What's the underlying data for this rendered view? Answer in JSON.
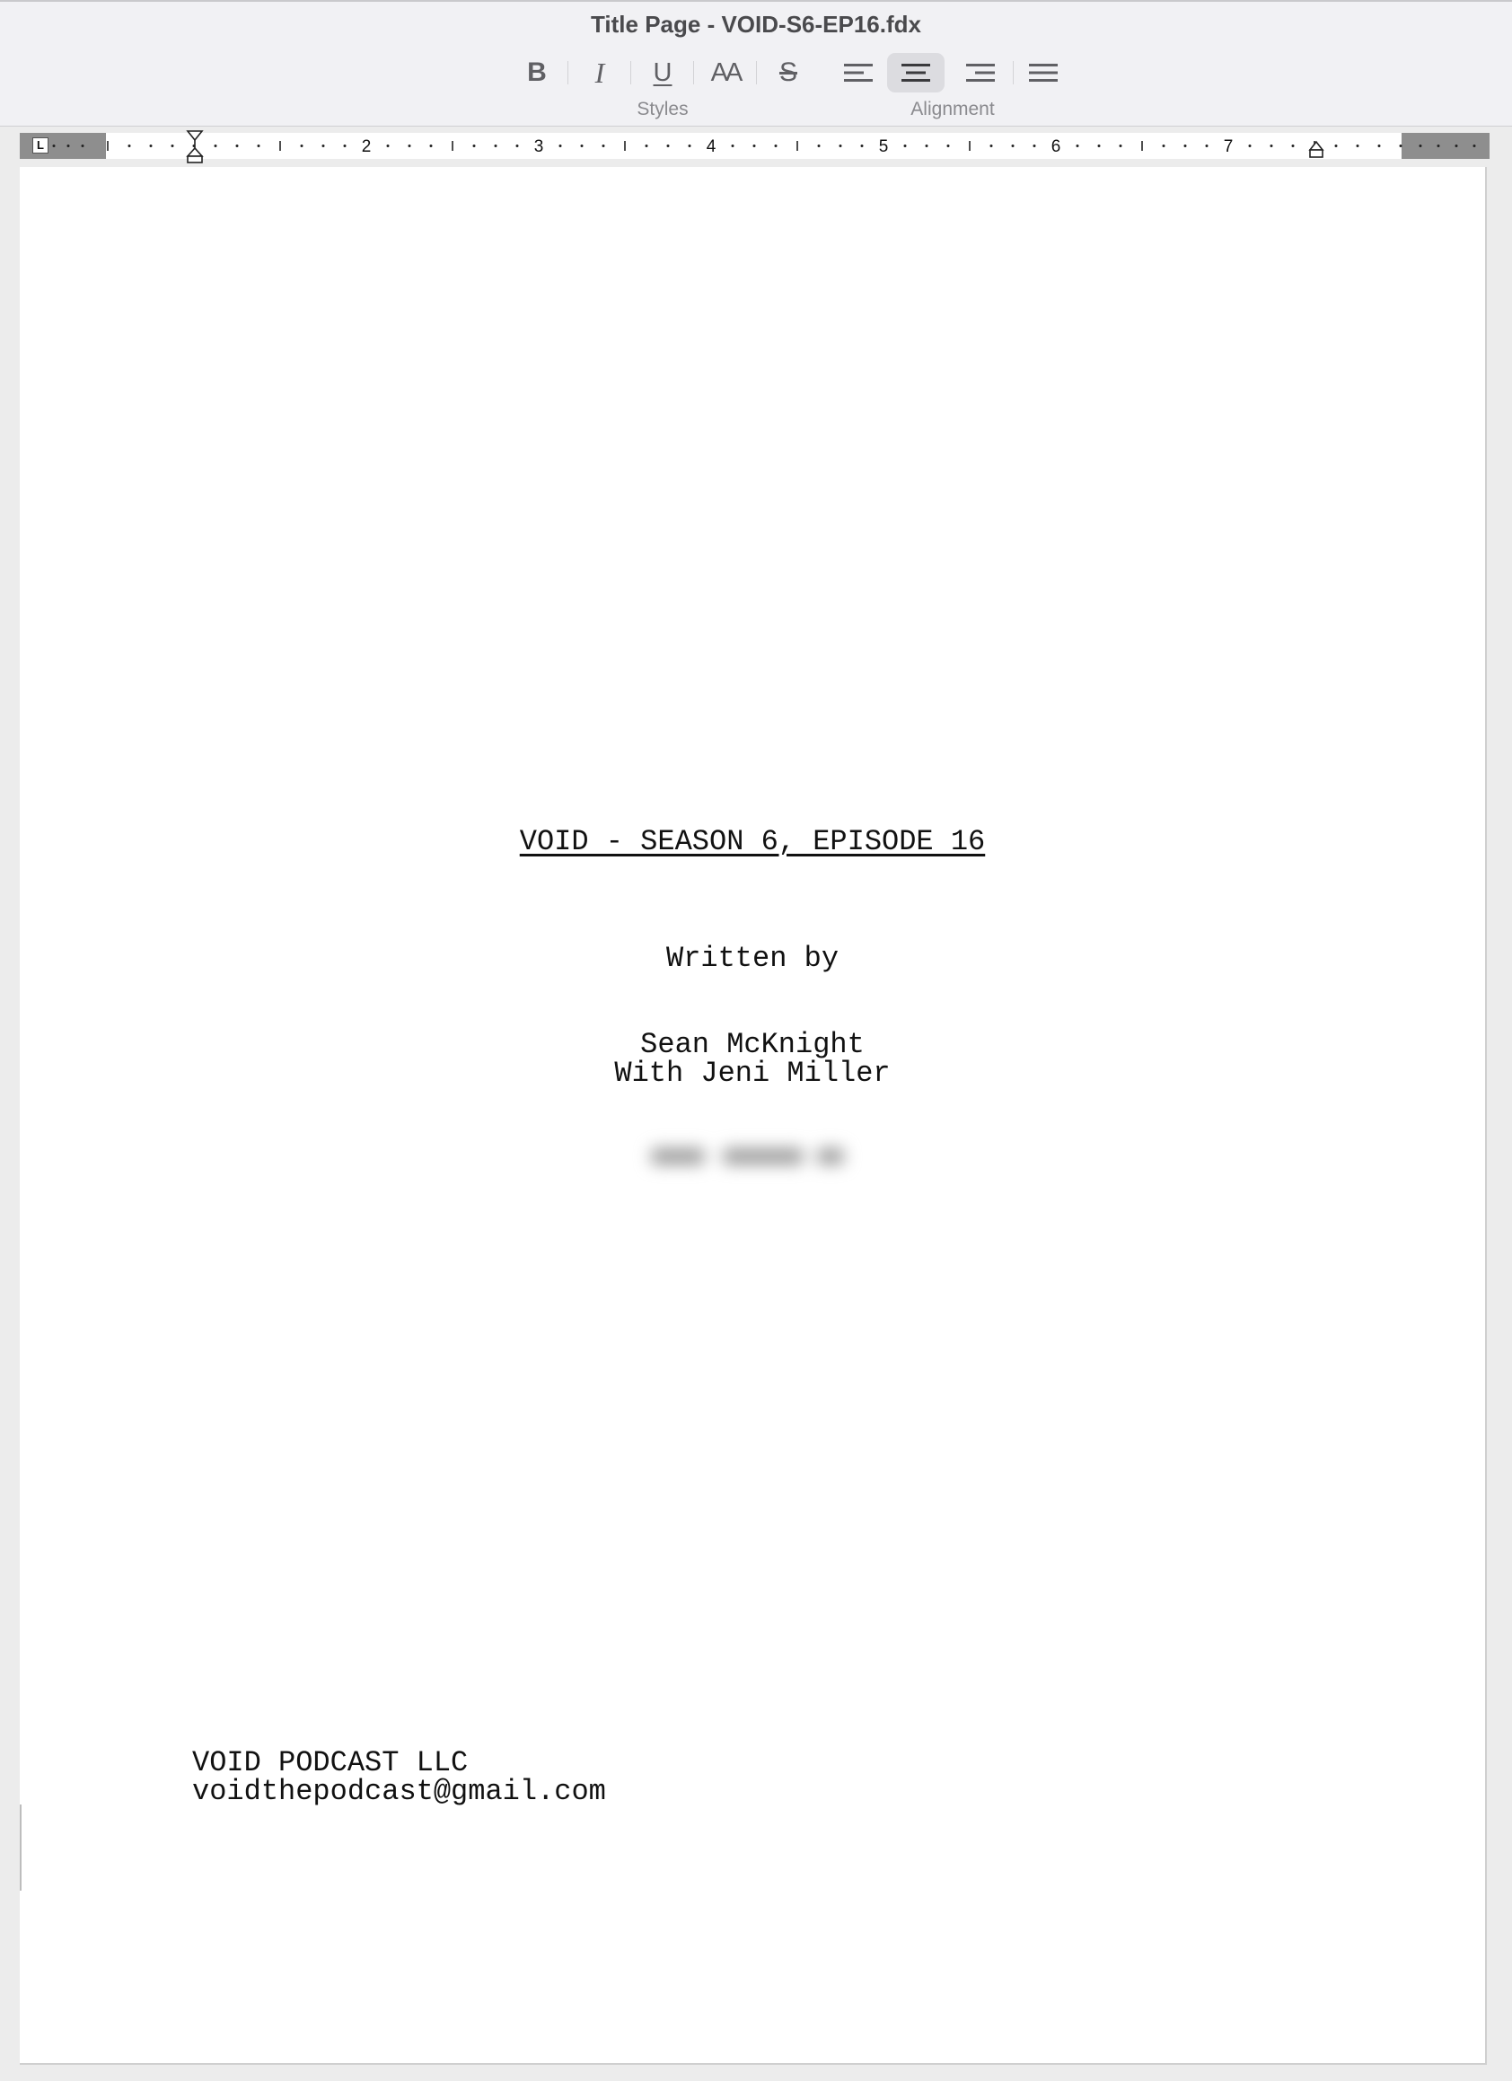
{
  "window": {
    "title": "Title Page - VOID-S6-EP16.fdx"
  },
  "toolbar": {
    "styles_label": "Styles",
    "alignment_label": "Alignment",
    "buttons": [
      {
        "name": "bold-button",
        "icon": "bold-icon"
      },
      {
        "name": "italic-button",
        "icon": "italic-icon"
      },
      {
        "name": "underline-button",
        "icon": "underline-icon"
      },
      {
        "name": "all-caps-button",
        "icon": "all-caps-icon"
      },
      {
        "name": "strikethrough-button",
        "icon": "strikethrough-icon"
      },
      {
        "name": "align-left-button",
        "icon": "align-left-icon"
      },
      {
        "name": "align-center-button",
        "icon": "align-center-icon",
        "active": true
      },
      {
        "name": "align-right-button",
        "icon": "align-right-icon"
      },
      {
        "name": "align-justify-button",
        "icon": "align-justify-icon"
      }
    ],
    "bold_glyph": "B",
    "italic_glyph": "I",
    "underline_glyph": "U",
    "caps_glyph": "AA",
    "strike_glyph": "S"
  },
  "ruler": {
    "tab_stop_glyph": "L",
    "numbers": [
      "2",
      "3",
      "4",
      "5",
      "6",
      "7"
    ]
  },
  "title_page": {
    "title": "VOID - SEASON 6, EPISODE 16",
    "credit": "Written by",
    "author_line_1": "Sean McKnight",
    "author_line_2": "With Jeni Miller",
    "contact_line_1": "VOID PODCAST LLC",
    "contact_line_2": "voidthepodcast@gmail.com"
  },
  "colors": {
    "toolbar_bg": "#f1f1f4",
    "active_button_bg": "#dcdce0",
    "page_bg": "#ffffff",
    "window_bg": "#ececec"
  }
}
